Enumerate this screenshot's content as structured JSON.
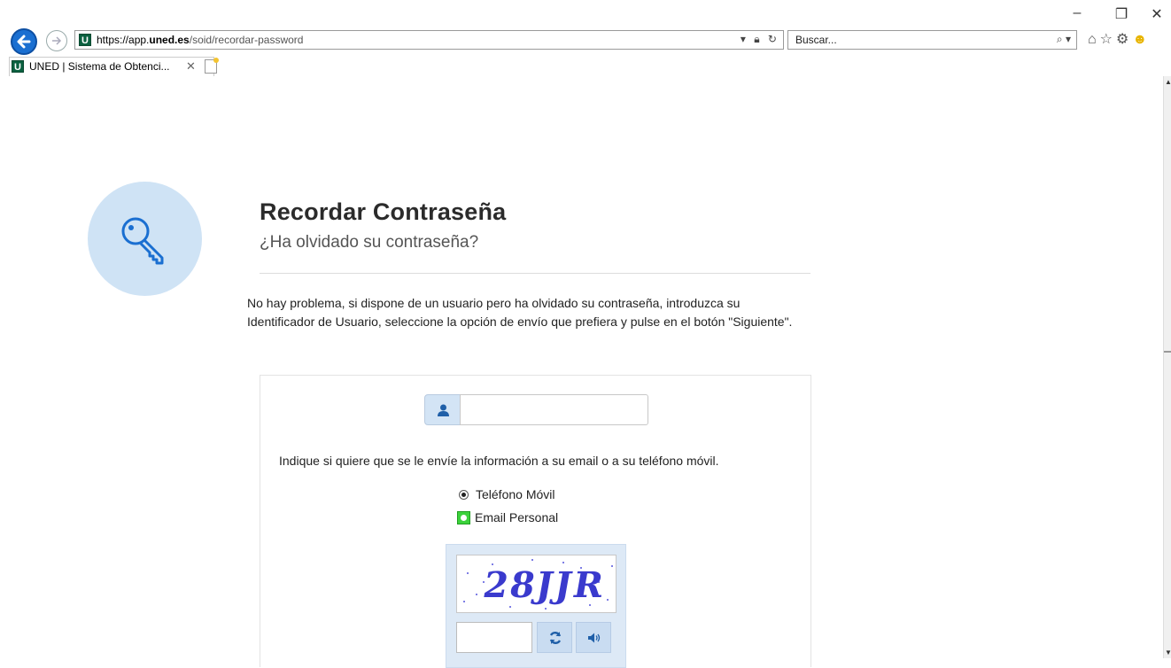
{
  "browser": {
    "url_scheme": "https://app.",
    "url_host": "uned.es",
    "url_path": "/soid/recordar-password",
    "search_placeholder": "Buscar...",
    "tab_title": "UNED | Sistema de Obtenci...",
    "favicon_letter": "U"
  },
  "page": {
    "title": "Recordar Contraseña",
    "subtitle": "¿Ha olvidado su contraseña?",
    "intro": "No hay problema, si dispone de un usuario pero ha olvidado su contraseña, introduzca su Identificador de Usuario, seleccione la opción de envío que prefiera y pulse en el botón \"Siguiente\".",
    "user_input_value": "",
    "send_prompt": "Indique si quiere que se le envíe la información a su email o a su teléfono móvil.",
    "options": [
      {
        "label": "Teléfono Móvil",
        "selected": true
      },
      {
        "label": "Email Personal",
        "selected": false
      }
    ],
    "captcha": {
      "image_text": "28JJR",
      "input_value": ""
    }
  },
  "colors": {
    "accent_light": "#cfe3f5",
    "icon_blue": "#1a6fd1",
    "uned_green": "#0b6140"
  }
}
